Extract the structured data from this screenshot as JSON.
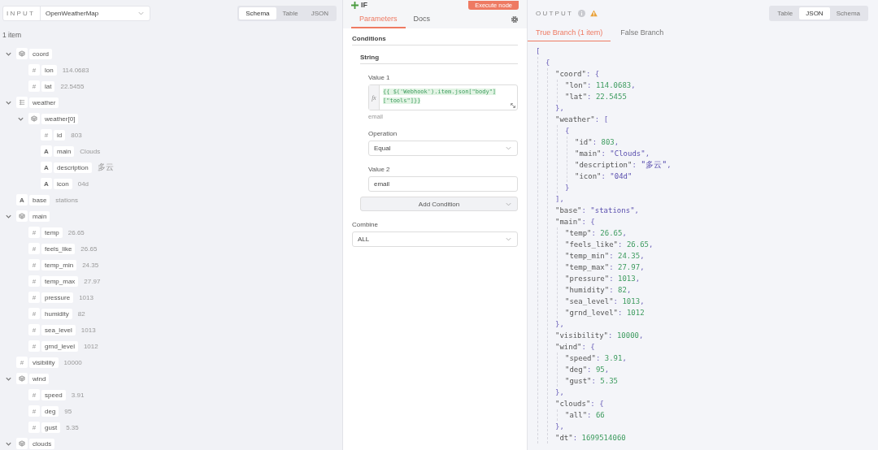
{
  "input": {
    "label": "INPUT",
    "source": "OpenWeatherMap",
    "views": [
      {
        "label": "Schema",
        "selected": true
      },
      {
        "label": "Table",
        "selected": false
      },
      {
        "label": "JSON",
        "selected": false
      }
    ],
    "count": "1 item",
    "schema": [
      {
        "kind": "object",
        "key": "coord",
        "expanded": true,
        "children": [
          {
            "kind": "number",
            "glyph": "#",
            "key": "lon",
            "value": "114.0683"
          },
          {
            "kind": "number",
            "glyph": "#",
            "key": "lat",
            "value": "22.5455"
          }
        ]
      },
      {
        "kind": "array",
        "key": "weather",
        "expanded": true,
        "children": [
          {
            "kind": "object",
            "key": "weather[0]",
            "expanded": true,
            "children": [
              {
                "kind": "number",
                "glyph": "#",
                "key": "id",
                "value": "803"
              },
              {
                "kind": "string",
                "glyph": "A",
                "key": "main",
                "value": "Clouds"
              },
              {
                "kind": "string",
                "glyph": "A",
                "key": "description",
                "value": "多云"
              },
              {
                "kind": "string",
                "glyph": "A",
                "key": "icon",
                "value": "04d"
              }
            ]
          }
        ]
      },
      {
        "kind": "string",
        "glyph": "A",
        "key": "base",
        "value": "stations"
      },
      {
        "kind": "object",
        "key": "main",
        "expanded": true,
        "children": [
          {
            "kind": "number",
            "glyph": "#",
            "key": "temp",
            "value": "26.65"
          },
          {
            "kind": "number",
            "glyph": "#",
            "key": "feels_like",
            "value": "26.65"
          },
          {
            "kind": "number",
            "glyph": "#",
            "key": "temp_min",
            "value": "24.35"
          },
          {
            "kind": "number",
            "glyph": "#",
            "key": "temp_max",
            "value": "27.97"
          },
          {
            "kind": "number",
            "glyph": "#",
            "key": "pressure",
            "value": "1013"
          },
          {
            "kind": "number",
            "glyph": "#",
            "key": "humidity",
            "value": "82"
          },
          {
            "kind": "number",
            "glyph": "#",
            "key": "sea_level",
            "value": "1013"
          },
          {
            "kind": "number",
            "glyph": "#",
            "key": "grnd_level",
            "value": "1012"
          }
        ]
      },
      {
        "kind": "number",
        "glyph": "#",
        "key": "visibility",
        "value": "10000"
      },
      {
        "kind": "object",
        "key": "wind",
        "expanded": true,
        "children": [
          {
            "kind": "number",
            "glyph": "#",
            "key": "speed",
            "value": "3.91"
          },
          {
            "kind": "number",
            "glyph": "#",
            "key": "deg",
            "value": "95"
          },
          {
            "kind": "number",
            "glyph": "#",
            "key": "gust",
            "value": "5.35"
          }
        ]
      },
      {
        "kind": "object",
        "key": "clouds",
        "expanded": true
      }
    ]
  },
  "node": {
    "title": "IF",
    "execute": "Execute node",
    "tabs": [
      {
        "label": "Parameters",
        "selected": true
      },
      {
        "label": "Docs",
        "selected": false
      }
    ],
    "conditions_title": "Conditions",
    "group_title": "String",
    "value1_label": "Value 1",
    "value1_prefix": "fx",
    "value1_expression": "{{ $('Webhook').item.json[\"body\"][\"tools\"]}}",
    "value1_hint": "email",
    "operation_label": "Operation",
    "operation": "Equal",
    "value2_label": "Value 2",
    "value2": "email",
    "add_condition": "Add Condition",
    "combine_label": "Combine",
    "combine": "ALL"
  },
  "output": {
    "label": "OUTPUT",
    "views": [
      {
        "label": "Table",
        "selected": false
      },
      {
        "label": "JSON",
        "selected": true
      },
      {
        "label": "Schema",
        "selected": false
      }
    ],
    "branches": [
      {
        "label": "True Branch (1 item)",
        "selected": true
      },
      {
        "label": "False Branch",
        "selected": false
      }
    ],
    "json": [
      {
        "open": "[",
        "children": [
          {
            "open": "{",
            "children": [
              {
                "open": "\"coord\": {",
                "close": "},",
                "children": [
                  {
                    "text": "\"lon\": 114.0683,"
                  },
                  {
                    "text": "\"lat\": 22.5455"
                  }
                ]
              },
              {
                "open": "\"weather\": [",
                "close": "],",
                "children": [
                  {
                    "open": "{",
                    "close": "}",
                    "children": [
                      {
                        "text": "\"id\": 803,"
                      },
                      {
                        "text": "\"main\": \"Clouds\","
                      },
                      {
                        "text": "\"description\": \"多云\","
                      },
                      {
                        "text": "\"icon\": \"04d\""
                      }
                    ]
                  }
                ]
              },
              {
                "text": "\"base\": \"stations\","
              },
              {
                "open": "\"main\": {",
                "close": "},",
                "children": [
                  {
                    "text": "\"temp\": 26.65,"
                  },
                  {
                    "text": "\"feels_like\": 26.65,"
                  },
                  {
                    "text": "\"temp_min\": 24.35,"
                  },
                  {
                    "text": "\"temp_max\": 27.97,"
                  },
                  {
                    "text": "\"pressure\": 1013,"
                  },
                  {
                    "text": "\"humidity\": 82,"
                  },
                  {
                    "text": "\"sea_level\": 1013,"
                  },
                  {
                    "text": "\"grnd_level\": 1012"
                  }
                ]
              },
              {
                "text": "\"visibility\": 10000,"
              },
              {
                "open": "\"wind\": {",
                "close": "},",
                "children": [
                  {
                    "text": "\"speed\": 3.91,"
                  },
                  {
                    "text": "\"deg\": 95,"
                  },
                  {
                    "text": "\"gust\": 5.35"
                  }
                ]
              },
              {
                "open": "\"clouds\": {",
                "close": "},",
                "children": [
                  {
                    "text": "\"all\": 66"
                  }
                ]
              },
              {
                "text": "\"dt\": 1699514060"
              }
            ]
          }
        ]
      }
    ]
  }
}
